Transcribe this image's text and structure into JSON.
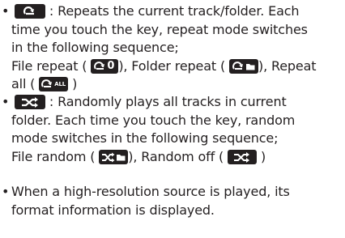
{
  "bullets": {
    "b1": "•",
    "b2": "•",
    "b3": "•"
  },
  "repeat": {
    "desc_1": " : Repeats the current track/folder. Each",
    "desc_2": "time you touch the key, repeat mode switches",
    "desc_3": "in the following sequence;",
    "file_repeat": "File repeat (",
    "folder_repeat": "), Folder repeat (",
    "repeat_tail": "), Repeat",
    "all_open": "all (",
    "all_close": " )"
  },
  "random": {
    "desc_1": " : Randomly plays all tracks in current",
    "desc_2": "folder. Each time you touch the key, random",
    "desc_3": "mode switches in the following sequence;",
    "file_random": "File random (",
    "random_off": "), Random off (",
    "close": " )"
  },
  "hires": {
    "line_1": "When a high-resolution source is played, its",
    "line_2": "format information is displayed."
  },
  "icons": {
    "repeat": "repeat-icon",
    "repeat_file": "repeat-file-icon",
    "repeat_folder": "repeat-folder-icon",
    "repeat_all": "repeat-all-icon",
    "random": "random-icon",
    "random_file": "random-file-icon",
    "random_off": "random-off-icon",
    "icon_fill": "#231f20",
    "icon_symbol": "#ffffff"
  },
  "icon_text": {
    "file_digit": "0",
    "all_label": "ALL"
  }
}
